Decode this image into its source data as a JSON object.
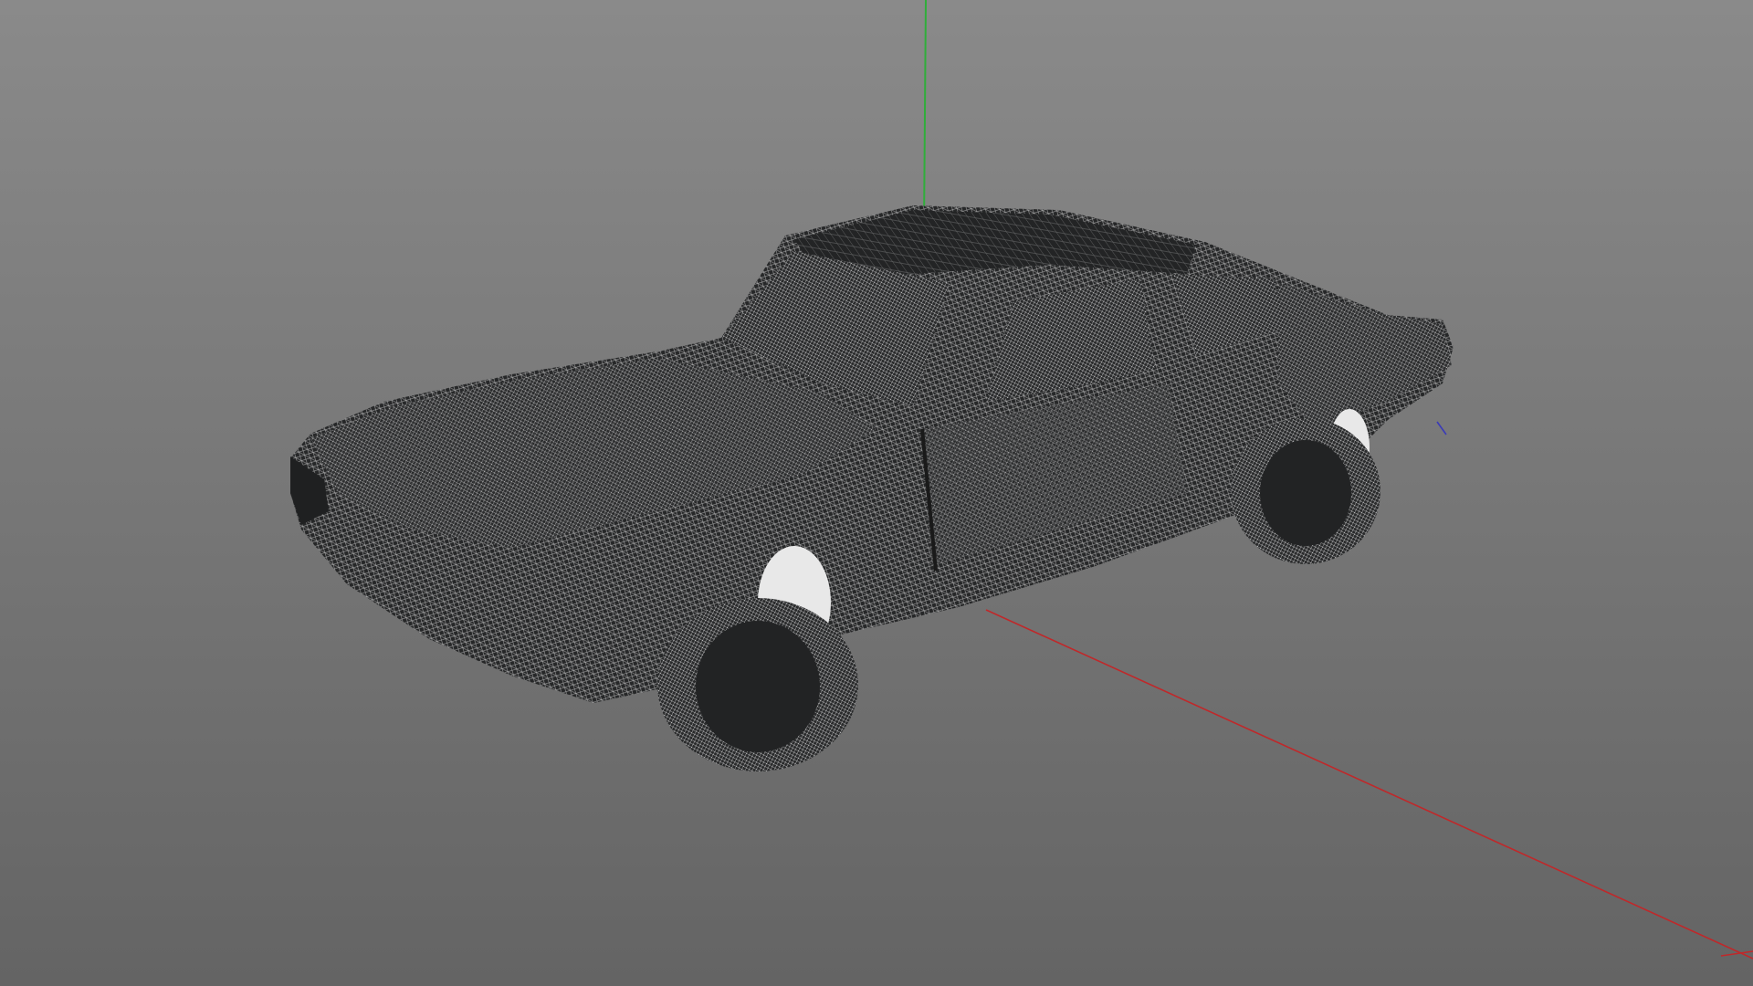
{
  "viewport": {
    "background_top": "#8a8a8a",
    "background_bottom": "#646464"
  },
  "axes": {
    "x_color": "#c0282a",
    "y_color": "#2fae3a",
    "z_color": "#3a3ab8"
  },
  "model": {
    "render_mode": "wireframe",
    "mesh_color": "#262728",
    "wire_color": "#e6e6e6",
    "icon": "car-model-icon"
  }
}
